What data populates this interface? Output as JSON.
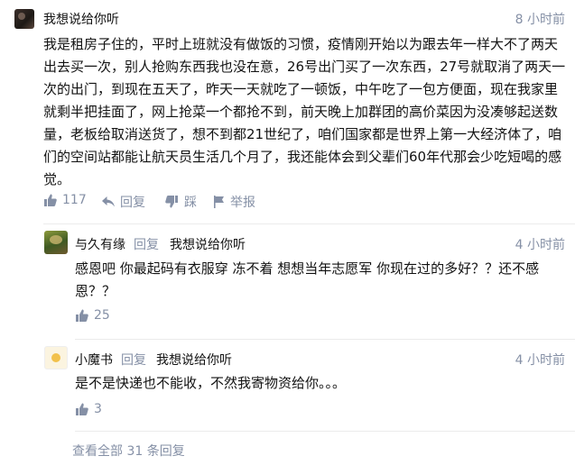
{
  "main_comment": {
    "author": "我想说给你听",
    "time": "8 小时前",
    "lines": [
      "我是租房子住的，平时上班就没有做饭的习惯，疫情刚开始以为跟去年一样大不了两天",
      "出去买一次，别人抢购东西我也没在意，26号出门买了一次东西，27号就取消了两天一",
      "次的出门，到现在五天了，昨天一天就吃了一顿饭，中午吃了一包方便面，现在我家里",
      "就剩半把挂面了，网上抢菜一个都抢不到，前天晚上加群团的高价菜因为没凑够起送数",
      "量，老板给取消送货了，想不到都21世纪了，咱们国家都是世界上第一大经济体了，咱",
      "们的空间站都能让航天员生活几个月了，我还能体会到父辈们60年代那会少吃短喝的感",
      "觉。"
    ],
    "likes": "117",
    "reply_label": "回复",
    "dislike_label": "踩",
    "report_label": "举报"
  },
  "replies": [
    {
      "author": "与久有缘",
      "reply_word": "回复",
      "reply_to": "我想说给你听",
      "time": "4 小时前",
      "lines": [
        "感恩吧 你最起码有衣服穿 冻不着 想想当年志愿军 你现在过的多好？？还不感",
        "恩？？"
      ],
      "likes": "25"
    },
    {
      "author": "小魔书",
      "reply_word": "回复",
      "reply_to": "我想说给你听",
      "time": "4 小时前",
      "lines": [
        "是不是快递也不能收，不然我寄物资给你。。。"
      ],
      "likes": "3"
    }
  ],
  "view_all": "查看全部 31 条回复",
  "colors": {
    "meta": "#8590a6",
    "text": "#121212",
    "divider": "#ebebeb"
  },
  "icons": [
    "thumb-up-icon",
    "reply-arrow-icon",
    "thumb-down-icon",
    "flag-icon"
  ]
}
